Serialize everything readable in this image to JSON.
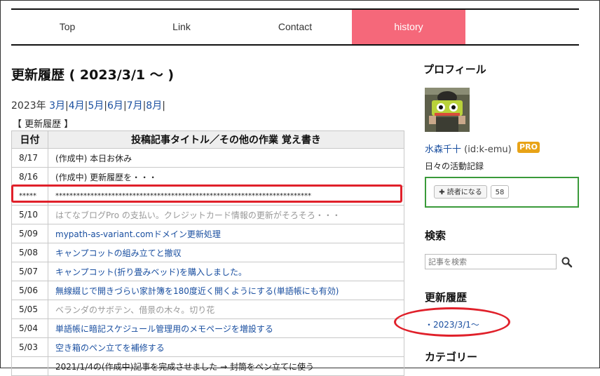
{
  "nav": {
    "items": [
      "Top",
      "Link",
      "Contact",
      "history"
    ],
    "active": "history"
  },
  "main": {
    "title": "更新履歴 ( 2023/3/1 ～ )",
    "year_label": "2023年",
    "months": [
      "3月",
      "4月",
      "5月",
      "6月",
      "7月",
      "8月"
    ],
    "section_label": "【 更新履歴 】",
    "table": {
      "headers": [
        "日付",
        "投稿記事タイトル／その他の作業 覚え書き"
      ],
      "rows": [
        {
          "date": "8/17",
          "text": "(作成中) 本日お休み",
          "style": "plain"
        },
        {
          "date": "8/16",
          "text": "(作成中) 更新履歴を・・・",
          "style": "plain"
        },
        {
          "date": "*****",
          "text": "*************************************************************************",
          "style": "plain"
        },
        {
          "date": "5/10",
          "text": "はてなブログPro の支払い。クレジットカード情報の更新がそろそろ・・・",
          "style": "gray"
        },
        {
          "date": "5/09",
          "text": "mypath-as-variant.comドメイン更新処理",
          "style": "link"
        },
        {
          "date": "5/08",
          "text": "キャンプコットの組み立てと撤収",
          "style": "link"
        },
        {
          "date": "5/07",
          "text": "キャンプコット(折り畳みベッド)を購入しました。",
          "style": "link"
        },
        {
          "date": "5/06",
          "text": "無線綴じで開きづらい家計簿を180度近く開くようにする(単語帳にも有効)",
          "style": "link"
        },
        {
          "date": "5/05",
          "text": "ベランダのサボテン、借景の木々。切り花",
          "style": "gray"
        },
        {
          "date": "5/04",
          "text": "単語帳に暗記スケジュール管理用のメモページを増設する",
          "style": "link"
        },
        {
          "date": "5/03",
          "text": "空き箱のペン立てを補修する",
          "style": "link"
        },
        {
          "date": "",
          "text": "2021/1/4の(作成中)記事を完成させました → 封筒をペン立てに使う",
          "style": "plain"
        }
      ]
    }
  },
  "sidebar": {
    "profile_heading": "プロフィール",
    "profile_name": "水森千十",
    "profile_id": "(id:k-emu)",
    "pro_badge": "PRO",
    "profile_desc": "日々の活動記録",
    "reader_button": "✚ 読者になる",
    "reader_count": "58",
    "search_heading": "検索",
    "search_placeholder": "記事を検索",
    "history_heading": "更新履歴",
    "history_link": "・2023/3/1～",
    "category_heading": "カテゴリー"
  },
  "colors": {
    "nav_active": "#f5687a",
    "link": "#1a4fa0",
    "highlight": "#e0202a",
    "box": "#3a9a3a",
    "pro": "#e8a317"
  }
}
